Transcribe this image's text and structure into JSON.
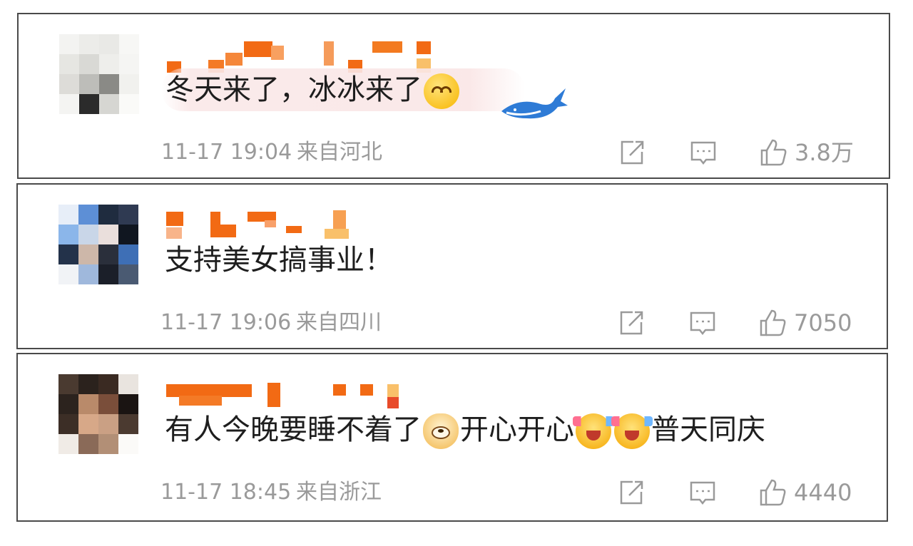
{
  "comments": [
    {
      "text": "冬天来了，冰冰来了",
      "emojis": [
        "smile-emoji"
      ],
      "timestamp": "11-17 19:04",
      "location": "来自河北",
      "likes": "3.8万"
    },
    {
      "text": "支持美女搞事业！",
      "timestamp": "11-17 19:06",
      "location": "来自四川",
      "likes": "7050"
    },
    {
      "text_part1": "有人今晚要睡不着了",
      "text_part2": "开心开心",
      "text_part3": "普天同庆",
      "emojis": [
        "doge-emoji",
        "cheer-emoji",
        "cheer-emoji"
      ],
      "timestamp": "11-17 18:45",
      "location": "来自浙江",
      "likes": "4440"
    }
  ],
  "colors": {
    "text": "#1e1e1e",
    "meta": "#9a9a9a",
    "border": "#4a4a4a",
    "username_mosaic": "#f26a14"
  },
  "icons": [
    "share-icon",
    "reply-icon",
    "like-icon"
  ]
}
